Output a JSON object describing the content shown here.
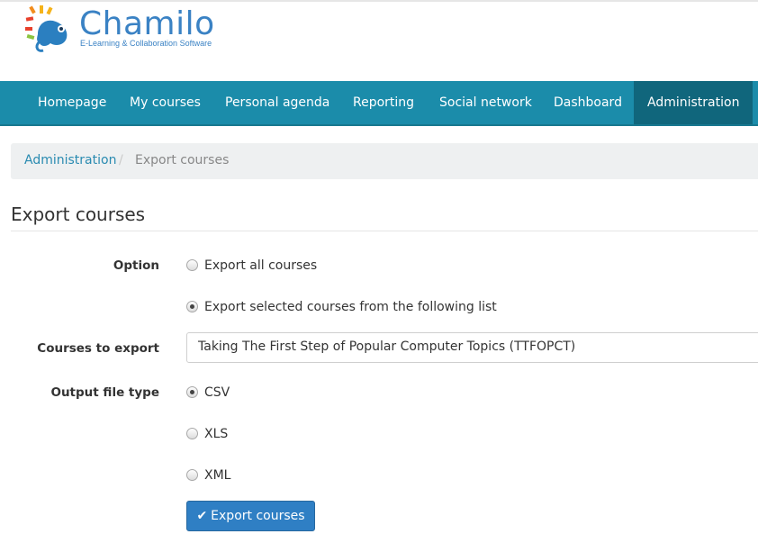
{
  "logo": {
    "title": "Chamilo",
    "subtitle": "E-Learning & Collaboration Software"
  },
  "nav": [
    {
      "label": "Homepage"
    },
    {
      "label": "My courses"
    },
    {
      "label": "Personal agenda"
    },
    {
      "label": "Reporting"
    },
    {
      "label": "Social network"
    },
    {
      "label": "Dashboard"
    },
    {
      "label": "Administration",
      "active": true
    }
  ],
  "breadcrumb": {
    "parent": "Administration",
    "separator": "/",
    "current": "Export courses"
  },
  "page": {
    "title": "Export courses"
  },
  "form": {
    "option_label": "Option",
    "option_all": "Export all courses",
    "option_selected": "Export selected courses from the following list",
    "option_value": "selected",
    "courses_label": "Courses to export",
    "courses_value": "Taking The First Step of Popular Computer Topics (TTFOPCT)",
    "filetype_label": "Output file type",
    "filetype_options": [
      "CSV",
      "XLS",
      "XML"
    ],
    "filetype_value": "CSV",
    "submit_label": "Export courses"
  },
  "colors": {
    "navbar": "#1b8caa",
    "nav_active": "#10667c",
    "link": "#2a8bb1",
    "button": "#2f7fc4"
  }
}
